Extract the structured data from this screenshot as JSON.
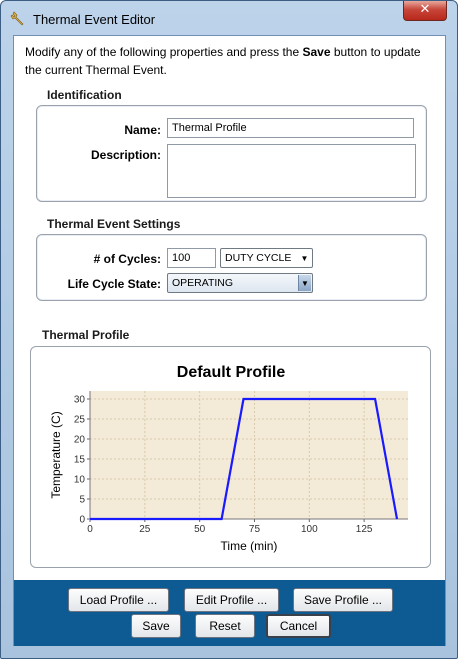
{
  "window": {
    "title": "Thermal Event Editor",
    "app_icon": "wrench-icon",
    "close_glyph": "✕"
  },
  "instructions": {
    "before": "Modify any of the following properties and press the ",
    "bold": "Save",
    "after": " button to update the current Thermal Event."
  },
  "identification": {
    "title": "Identification",
    "name_label": "Name:",
    "name_value": "Thermal Profile",
    "description_label": "Description:",
    "description_value": ""
  },
  "settings": {
    "title": "Thermal Event Settings",
    "cycles_label": "# of Cycles:",
    "cycles_value": "100",
    "cycle_unit": "DUTY CYCLE",
    "lifecycle_label": "Life Cycle State:",
    "lifecycle_value": "OPERATING"
  },
  "profile_section": {
    "title": "Thermal Profile"
  },
  "chart_data": {
    "type": "line",
    "title": "Default Profile",
    "xlabel": "Time (min)",
    "ylabel": "Temperature (C)",
    "xlim": [
      0,
      145
    ],
    "ylim": [
      0,
      32
    ],
    "x_ticks": [
      0,
      25,
      50,
      75,
      100,
      125
    ],
    "y_ticks": [
      0,
      5,
      10,
      15,
      20,
      25,
      30
    ],
    "grid": true,
    "line_color": "#1a1aff",
    "plot_background": "#f4ead8",
    "series": [
      {
        "x": [
          0,
          60,
          70,
          130,
          140
        ],
        "y": [
          0,
          0,
          30,
          30,
          0
        ]
      }
    ]
  },
  "buttons": {
    "load": "Load Profile ...",
    "edit": "Edit Profile ...",
    "save_profile": "Save Profile ...",
    "save": "Save",
    "reset": "Reset",
    "cancel": "Cancel"
  },
  "colors": {
    "button_bar": "#0e5a92",
    "window_frame": "#b4cce6"
  }
}
